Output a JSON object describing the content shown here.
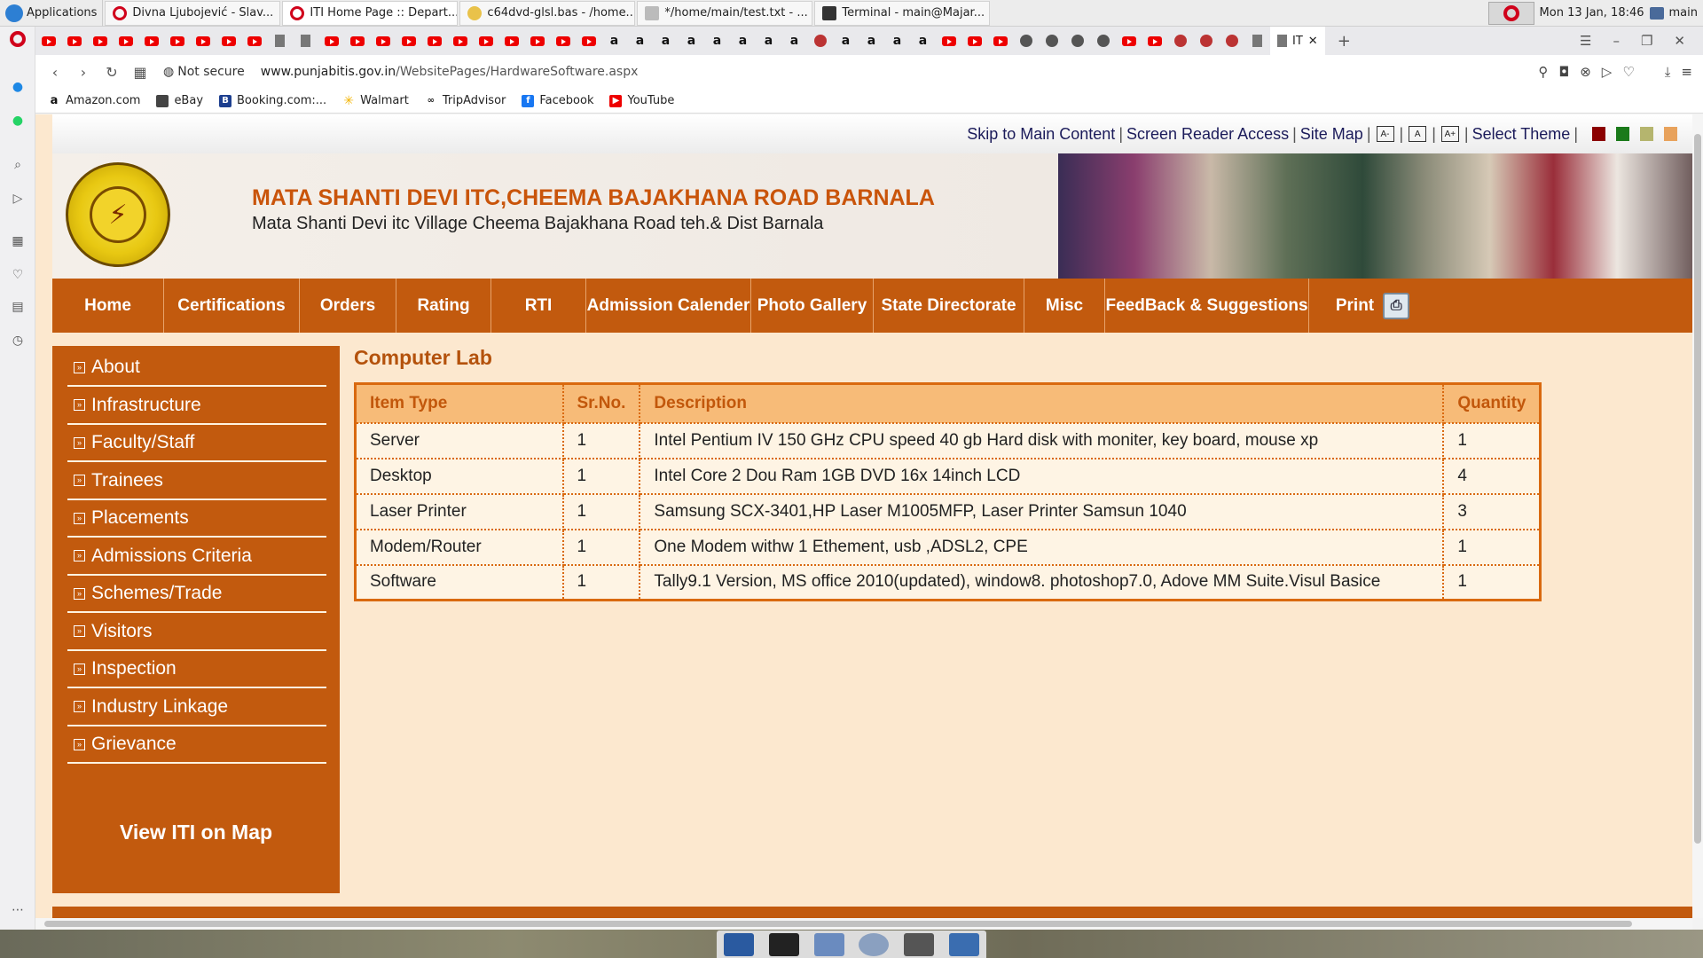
{
  "os": {
    "apps_label": "Applications",
    "tasks": [
      "Divna Ljubojević - Slav...",
      "ITI Home Page :: Depart...",
      "c64dvd-glsl.bas - /home...",
      "*/home/main/test.txt - ...",
      "Terminal - main@Majar..."
    ],
    "clock": "Mon 13 Jan, 18:46",
    "user": "main"
  },
  "browser": {
    "active_tab_label": "IT",
    "security_label": "Not secure",
    "url_domain": "www.punjabitis.gov.in",
    "url_path": "/WebsitePages/HardwareSoftware.aspx",
    "bookmarks": [
      "Amazon.com",
      "eBay",
      "Booking.com:...",
      "Walmart",
      "TripAdvisor",
      "Facebook",
      "YouTube"
    ]
  },
  "site": {
    "top_links": [
      "Skip to Main Content",
      "Screen Reader Access",
      "Site Map"
    ],
    "font_buttons": [
      "A-",
      "A",
      "A+"
    ],
    "select_theme": "Select Theme",
    "theme_colors": [
      "#8b0000",
      "#1a7a1a",
      "#b5b56e",
      "#e8a25c"
    ],
    "title": "MATA SHANTI DEVI ITC,CHEEMA BAJAKHANA ROAD BARNALA",
    "subtitle": "Mata Shanti Devi itc Village Cheema Bajakhana Road teh.& Dist Barnala",
    "nav": [
      "Home",
      "Certifications",
      "Orders",
      "Rating",
      "RTI",
      "Admission Calender",
      "Photo Gallery",
      "State Directorate",
      "Misc",
      "FeedBack & Suggestions",
      "Print"
    ],
    "sidebar": [
      "About",
      "Infrastructure",
      "Faculty/Staff",
      "Trainees",
      "Placements",
      "Admissions Criteria",
      "Schemes/Trade",
      "Visitors",
      "Inspection",
      "Industry Linkage",
      "Grievance"
    ],
    "view_map": "View ITI on Map",
    "accent_color": "#c25a0e"
  },
  "content": {
    "title": "Computer Lab",
    "columns": [
      "Item Type",
      "Sr.No.",
      "Description",
      "Quantity"
    ],
    "rows": [
      [
        "Server",
        "1",
        "Intel Pentium IV 150 GHz CPU speed 40 gb Hard disk with moniter, key board, mouse xp",
        "1"
      ],
      [
        "Desktop",
        "1",
        "Intel Core 2 Dou Ram 1GB DVD 16x 14inch LCD",
        "4"
      ],
      [
        "Laser Printer",
        "1",
        "Samsung SCX-3401,HP Laser M1005MFP, Laser Printer Samsun 1040",
        "3"
      ],
      [
        "Modem/Router",
        "1",
        "One Modem withw 1 Ethement, usb ,ADSL2, CPE",
        "1"
      ],
      [
        "Software",
        "1",
        "Tally9.1 Version, MS office 2010(updated), window8. photoshop7.0, Adove MM Suite.Visul Basice",
        "1"
      ]
    ]
  }
}
